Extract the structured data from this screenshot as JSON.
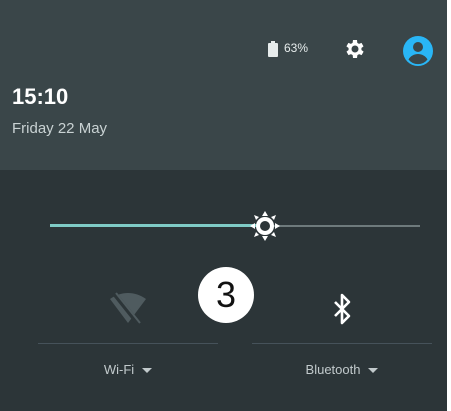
{
  "status": {
    "battery_percent": "63%",
    "battery_icon": "battery-icon",
    "settings_icon": "gear-icon",
    "account_icon": "account-circle-icon"
  },
  "clock": {
    "time": "15:10",
    "date": "Friday 22 May"
  },
  "brightness": {
    "icon": "brightness-icon",
    "level": 0.58
  },
  "marker_label": "3",
  "tiles": [
    {
      "label": "Wi-Fi",
      "icon": "wifi-off-icon"
    },
    {
      "label": "Bluetooth",
      "icon": "bluetooth-icon"
    }
  ],
  "colors": {
    "accent": "#7fcbc6",
    "header_bg": "#3a4649",
    "panel_bg": "#2c3538"
  }
}
